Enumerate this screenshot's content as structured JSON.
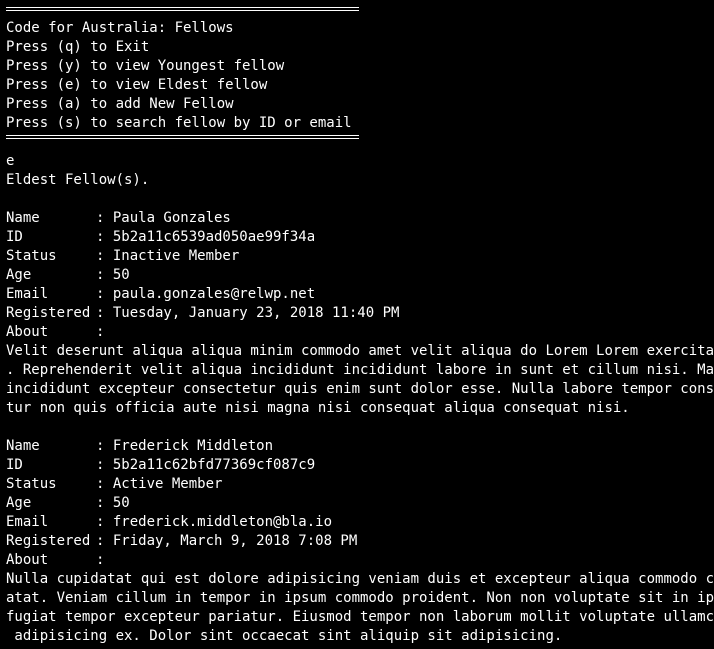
{
  "menu": {
    "title": "Code for Australia: Fellows",
    "options": [
      "Press (q) to Exit",
      "Press (y) to view Youngest fellow",
      "Press (e) to view Eldest fellow",
      "Press (a) to add New Fellow",
      "Press (s) to search fellow by ID or email"
    ]
  },
  "input": "e",
  "result_heading": "Eldest Fellow(s).",
  "fellows": [
    {
      "name_label": "Name",
      "name": "Paula Gonzales",
      "id_label": "ID",
      "id": "5b2a11c6539ad050ae99f34a",
      "status_label": "Status",
      "status": "Inactive Member",
      "age_label": "Age",
      "age": "50",
      "email_label": "Email",
      "email": "paula.gonzales@relwp.net",
      "registered_label": "Registered",
      "registered": "Tuesday, January 23, 2018 11:40 PM",
      "about_label": "About",
      "about_lines": [
        "Velit deserunt aliqua aliqua minim commodo amet velit aliqua do Lorem Lorem exercitation",
        ". Reprehenderit velit aliqua incididunt incididunt labore in sunt et cillum nisi. Magna",
        "incididunt excepteur consectetur quis enim sunt dolor esse. Nulla labore tempor consecte",
        "tur non quis officia aute nisi magna nisi consequat aliqua consequat nisi."
      ]
    },
    {
      "name_label": "Name",
      "name": "Frederick Middleton",
      "id_label": "ID",
      "id": "5b2a11c62bfd77369cf087c9",
      "status_label": "Status",
      "status": "Active Member",
      "age_label": "Age",
      "age": "50",
      "email_label": "Email",
      "email": "frederick.middleton@bla.io",
      "registered_label": "Registered",
      "registered": "Friday, March 9, 2018 7:08 PM",
      "about_label": "About",
      "about_lines": [
        "Nulla cupidatat qui est dolore adipisicing veniam duis et excepteur aliqua commodo cupid",
        "atat. Veniam cillum in tempor in ipsum commodo proident. Non non voluptate sit in ipsum",
        "fugiat tempor excepteur pariatur. Eiusmod tempor non laborum mollit voluptate ullamco do",
        " adipisicing ex. Dolor sint occaecat sint aliquip sit adipisicing."
      ]
    }
  ]
}
